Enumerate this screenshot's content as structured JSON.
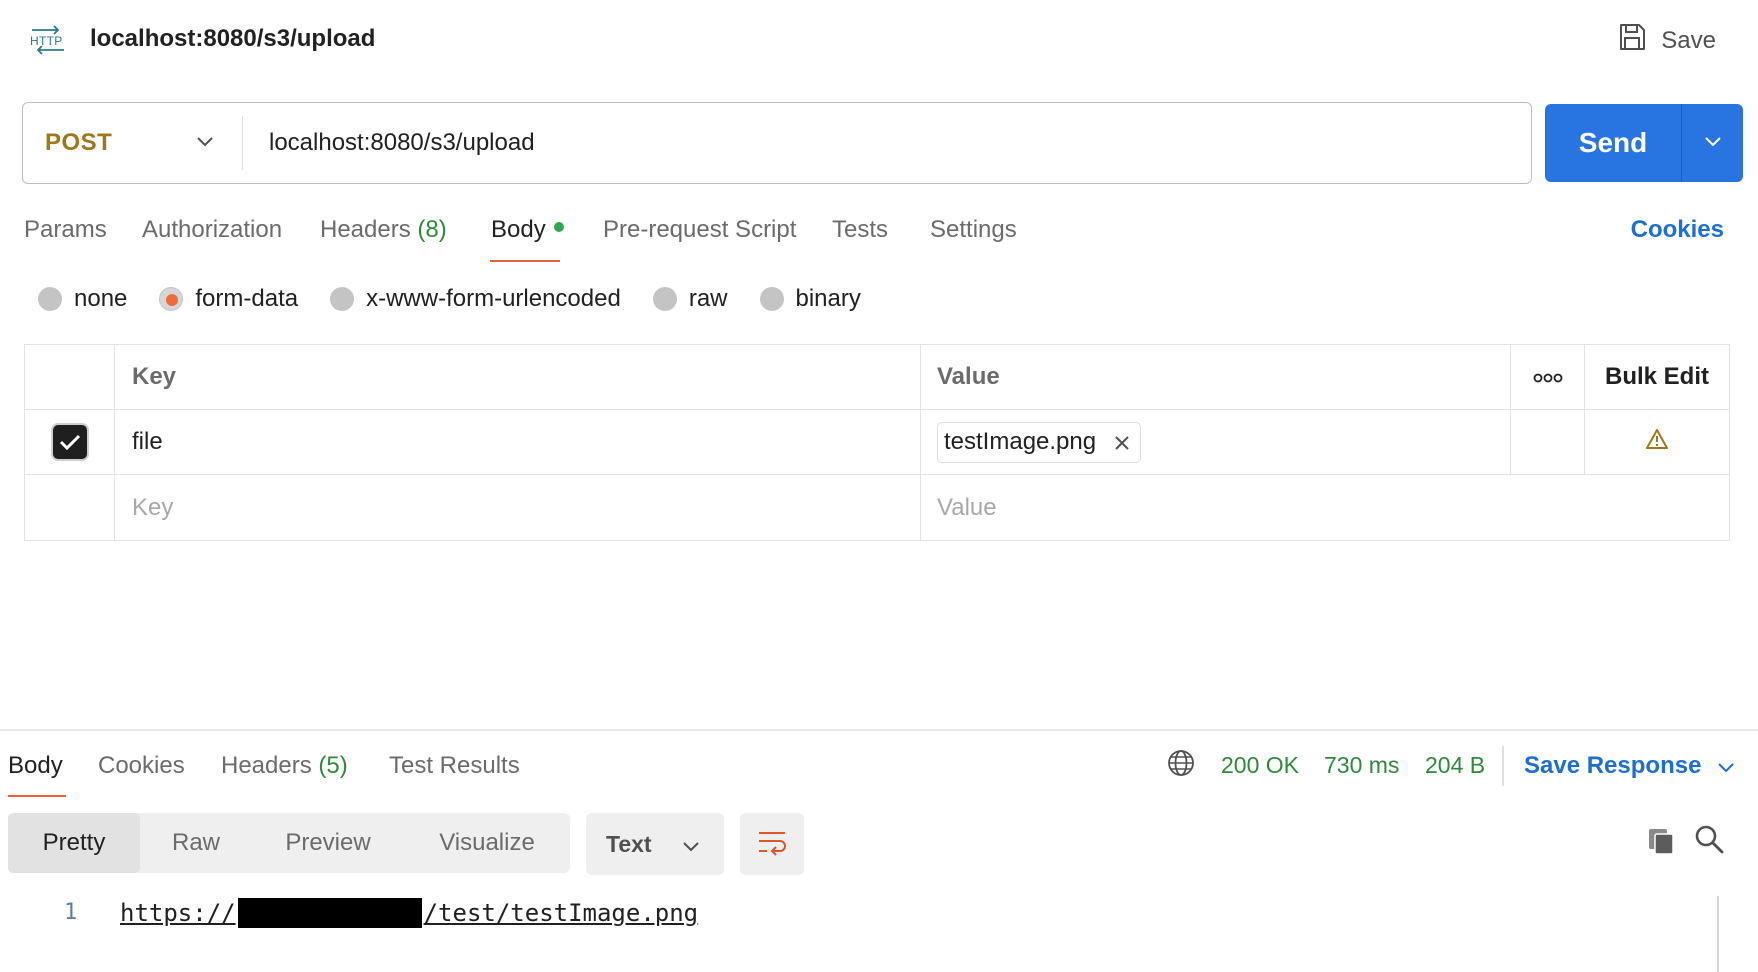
{
  "header": {
    "icon": "http-icon",
    "title": "localhost:8080/s3/upload",
    "save_label": "Save"
  },
  "request": {
    "method": "POST",
    "url": "localhost:8080/s3/upload",
    "send_label": "Send"
  },
  "tabs": {
    "params": "Params",
    "authorization": "Authorization",
    "headers_label": "Headers",
    "headers_count": "(8)",
    "body": "Body",
    "prerequest": "Pre-request Script",
    "tests": "Tests",
    "settings": "Settings",
    "cookies": "Cookies"
  },
  "body_types": {
    "none": "none",
    "form_data": "form-data",
    "urlencoded": "x-www-form-urlencoded",
    "raw": "raw",
    "binary": "binary",
    "selected": "form-data"
  },
  "form_table": {
    "key_header": "Key",
    "value_header": "Value",
    "more_label": "ooo",
    "bulk_edit": "Bulk Edit",
    "row": {
      "key": "file",
      "value": "testImage.png",
      "checked": true
    },
    "key_placeholder": "Key",
    "value_placeholder": "Value"
  },
  "response": {
    "tabs": {
      "body": "Body",
      "cookies": "Cookies",
      "headers_label": "Headers",
      "headers_count": "(5)",
      "test_results": "Test Results"
    },
    "status": "200 OK",
    "time": "730 ms",
    "size": "204 B",
    "save_response": "Save Response",
    "views": {
      "pretty": "Pretty",
      "raw": "Raw",
      "preview": "Preview",
      "visualize": "Visualize"
    },
    "format": "Text",
    "line_number": "1",
    "line_prefix": "https://",
    "line_suffix": "/test/testImage.png"
  },
  "colors": {
    "method": "#A0781A",
    "send": "#2874E0",
    "accent_underline": "#E8633B",
    "link": "#1d6fd6",
    "status_green": "#2e8b3a"
  }
}
